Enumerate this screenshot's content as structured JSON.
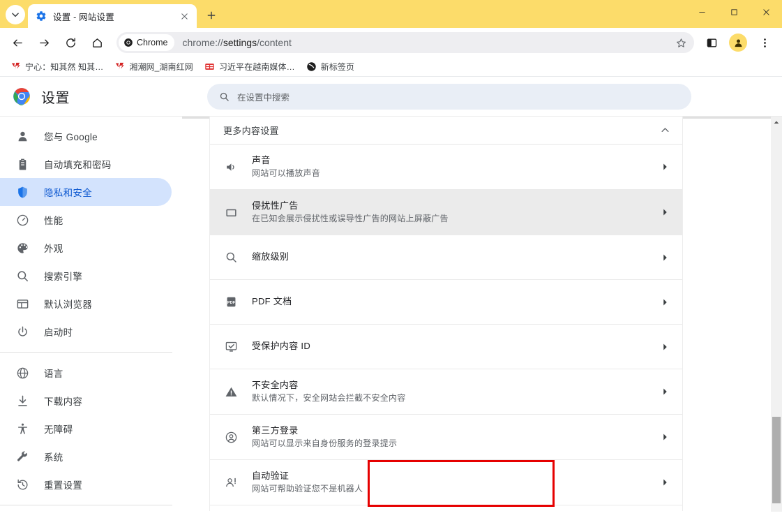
{
  "window": {
    "tab": {
      "title": "设置 - 网站设置",
      "favicon_icon": "gear-icon"
    },
    "tab_search_icon": "chevron-down-icon",
    "new_tab_icon": "plus-icon",
    "controls": {
      "minimize": "minimize-icon",
      "maximize": "maximize-icon",
      "close": "close-icon"
    },
    "accent_color": "#fcdc6a"
  },
  "toolbar": {
    "back_icon": "back-arrow-icon",
    "forward_icon": "forward-arrow-icon",
    "reload_icon": "reload-icon",
    "home_icon": "home-icon",
    "chrome_chip_label": "Chrome",
    "url_prefix": "chrome://",
    "url_bold": "settings",
    "url_suffix": "/content",
    "url_full": "chrome://settings/content",
    "star_icon": "star-outline-icon",
    "side_panel_icon": "side-panel-icon",
    "profile_icon": "avatar-icon",
    "menu_icon": "three-dot-menu-icon"
  },
  "bookmarks": [
    {
      "label": "宁心：知其然 知其…",
      "icon": "red-site-icon"
    },
    {
      "label": "湘潮网_湖南红网",
      "icon": "red-site-icon"
    },
    {
      "label": "习近平在越南媒体…",
      "icon": "toutiao-icon"
    },
    {
      "label": "新标签页",
      "icon": "globe-dark-icon"
    }
  ],
  "settings_header": {
    "logo_icon": "chrome-logo-icon",
    "title": "设置",
    "search_icon": "search-icon",
    "search_placeholder": "在设置中搜索"
  },
  "sidebar": {
    "groups": [
      {
        "items": [
          {
            "label": "您与 Google",
            "icon": "person-icon",
            "active": false
          },
          {
            "label": "自动填充和密码",
            "icon": "clipboard-icon",
            "active": false
          },
          {
            "label": "隐私和安全",
            "icon": "shield-icon",
            "active": true
          },
          {
            "label": "性能",
            "icon": "speedometer-icon",
            "active": false
          },
          {
            "label": "外观",
            "icon": "palette-icon",
            "active": false
          },
          {
            "label": "搜索引擎",
            "icon": "search-icon",
            "active": false
          },
          {
            "label": "默认浏览器",
            "icon": "browser-window-icon",
            "active": false
          },
          {
            "label": "启动时",
            "icon": "power-icon",
            "active": false
          }
        ]
      },
      {
        "items": [
          {
            "label": "语言",
            "icon": "globe-icon",
            "active": false
          },
          {
            "label": "下载内容",
            "icon": "download-icon",
            "active": false
          },
          {
            "label": "无障碍",
            "icon": "accessibility-icon",
            "active": false
          },
          {
            "label": "系统",
            "icon": "wrench-icon",
            "active": false
          },
          {
            "label": "重置设置",
            "icon": "history-restore-icon",
            "active": false
          }
        ]
      }
    ],
    "active_bg": "#d3e3fd",
    "active_fg": "#0b57d0"
  },
  "content": {
    "section_title": "更多内容设置",
    "collapse_icon": "chevron-up-icon",
    "rows": [
      {
        "title": "声音",
        "sub": "网站可以播放声音",
        "icon": "volume-icon",
        "shaded": false,
        "arrow_icon": "chevron-right-icon"
      },
      {
        "title": "侵扰性广告",
        "sub": "在已知会展示侵扰性或误导性广告的网站上屏蔽广告",
        "icon": "ad-block-icon",
        "shaded": true,
        "arrow_icon": "chevron-right-icon"
      },
      {
        "title": "缩放级别",
        "sub": "",
        "icon": "zoom-search-icon",
        "shaded": false,
        "arrow_icon": "chevron-right-icon"
      },
      {
        "title": "PDF 文档",
        "sub": "",
        "icon": "pdf-icon",
        "shaded": false,
        "arrow_icon": "chevron-right-icon"
      },
      {
        "title": "受保护内容 ID",
        "sub": "",
        "icon": "protected-content-icon",
        "shaded": false,
        "arrow_icon": "chevron-right-icon"
      },
      {
        "title": "不安全内容",
        "sub": "默认情况下，安全网站会拦截不安全内容",
        "icon": "warning-icon",
        "shaded": false,
        "arrow_icon": "chevron-right-icon"
      },
      {
        "title": "第三方登录",
        "sub": "网站可以显示来自身份服务的登录提示",
        "icon": "account-circle-icon",
        "shaded": false,
        "arrow_icon": "chevron-right-icon"
      },
      {
        "title": "自动验证",
        "sub": "网站可帮助验证您不是机器人",
        "icon": "person-alert-icon",
        "shaded": false,
        "arrow_icon": "chevron-right-icon",
        "highlighted": true
      }
    ],
    "highlight_color": "#e60000"
  },
  "scrollbar": {
    "up_arrow_icon": "scroll-up-icon"
  }
}
